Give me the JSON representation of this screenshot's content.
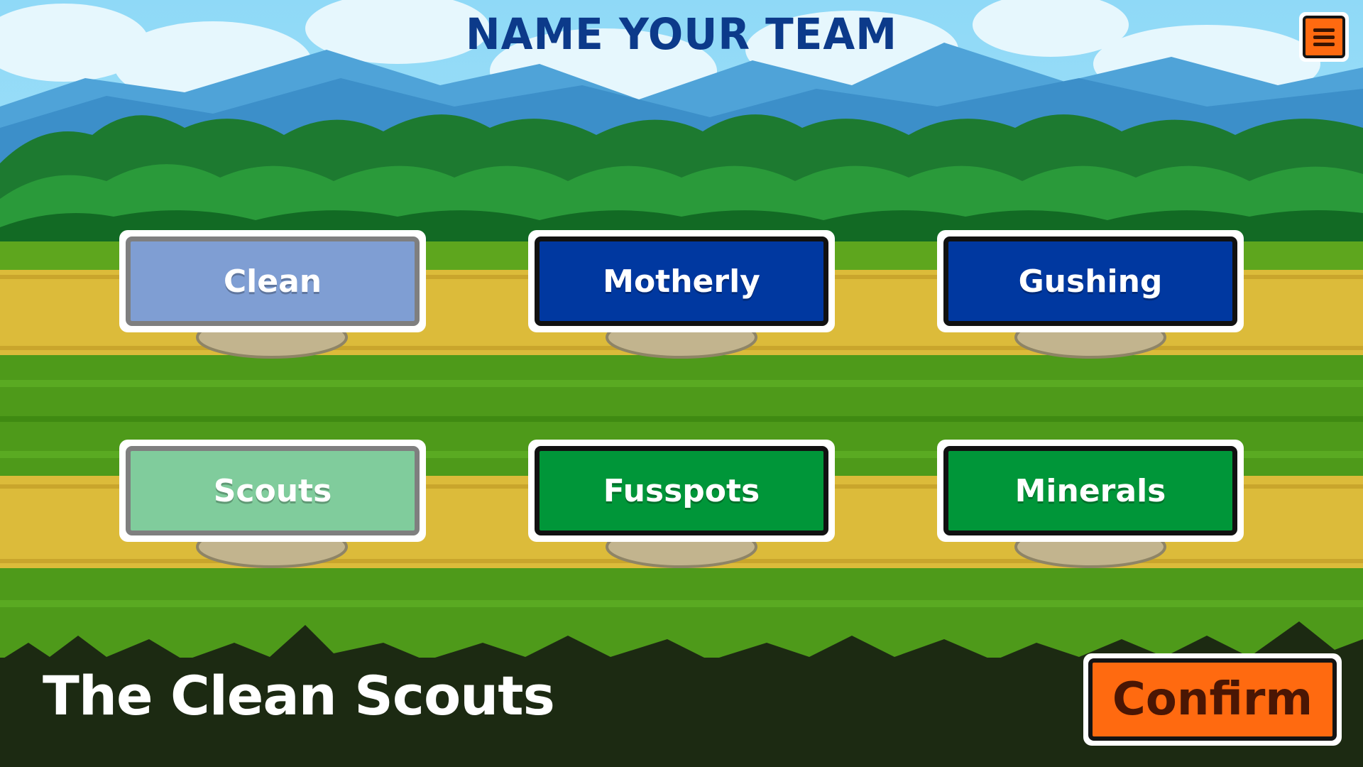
{
  "screen": {
    "title": "NAME YOUR TEAM"
  },
  "menu": {
    "icon": "hamburger-menu-icon",
    "color": "#ff6a10"
  },
  "adjectives": [
    {
      "label": "Clean",
      "selected": true,
      "color": "#7f9ed3"
    },
    {
      "label": "Motherly",
      "selected": false,
      "color": "#0038a0"
    },
    {
      "label": "Gushing",
      "selected": false,
      "color": "#0038a0"
    }
  ],
  "nouns": [
    {
      "label": "Scouts",
      "selected": true,
      "color": "#80cc9c"
    },
    {
      "label": "Fusspots",
      "selected": false,
      "color": "#009639"
    },
    {
      "label": "Minerals",
      "selected": false,
      "color": "#009639"
    }
  ],
  "footer": {
    "team_name": "The Clean Scouts",
    "confirm_label": "Confirm"
  },
  "colors": {
    "title": "#0c3a8a",
    "accent_orange": "#ff6a10",
    "footer_bg": "#1c2a12"
  }
}
